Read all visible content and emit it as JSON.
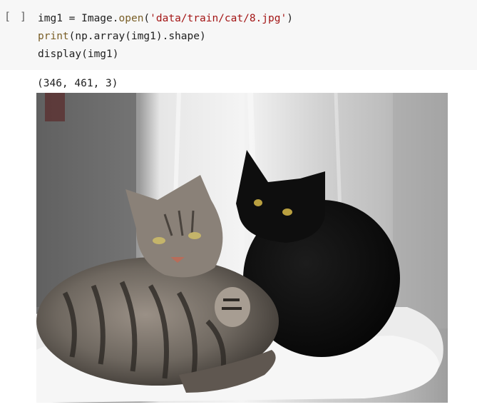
{
  "cell": {
    "prompt": "[ ]",
    "lines": {
      "l1_pre": "img1 = Image.",
      "l1_fn": "open",
      "l1_paren": "(",
      "l1_str": "'data/train/cat/8.jpg'",
      "l1_end": ")",
      "l2_fn": "print",
      "l2_rest": "(np.array(img1).shape)",
      "l3": "display(img1)"
    }
  },
  "output": {
    "shape_text": "(346, 461, 3)",
    "image_subject": "two cats lying on a white fluffy cat bed: a gray striped tabby in front and a black cat behind"
  },
  "colors": {
    "cell_bg": "#f7f7f7",
    "string": "#a31515",
    "function": "#795e26",
    "text": "#212121"
  }
}
